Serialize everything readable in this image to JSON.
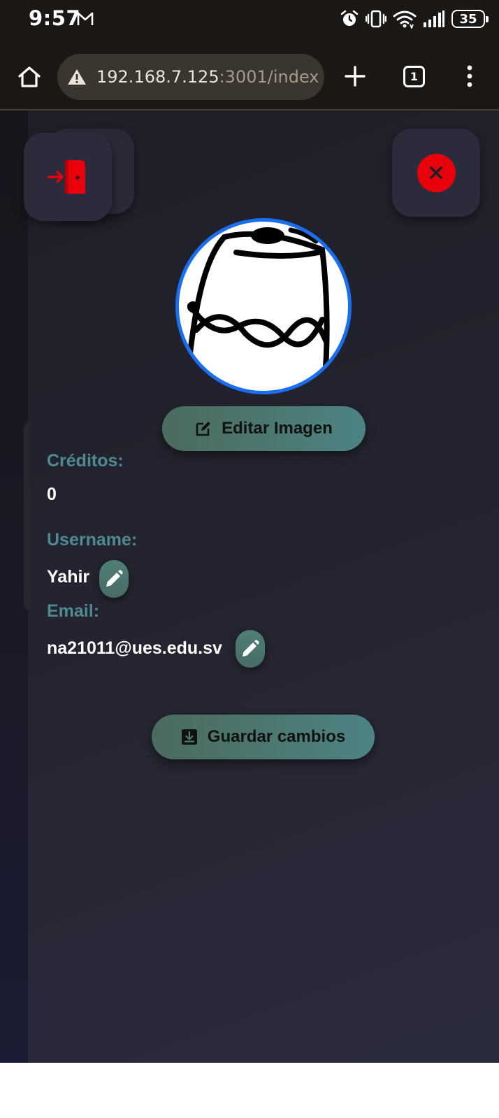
{
  "status_bar": {
    "time": "9:57",
    "battery_level": "35",
    "icons": [
      "gmail-icon",
      "alarm-icon",
      "vibrate-icon",
      "wifi-icon",
      "signal-icon",
      "battery-icon"
    ]
  },
  "browser": {
    "url_host": "192.168.7.125",
    "url_path": ":3001/index",
    "tab_count": "1",
    "icons": [
      "home-icon",
      "not-secure-warning-icon",
      "new-tab-plus-icon",
      "tab-switcher-icon",
      "overflow-menu-icon"
    ]
  },
  "profile": {
    "edit_image_label": "Editar Imagen",
    "credits_label": "Créditos:",
    "credits_value": "0",
    "username_label": "Username:",
    "username_value": "Yahir",
    "email_label": "Email:",
    "email_value": "na21011@ues.edu.sv",
    "save_label": "Guardar cambios"
  },
  "colors": {
    "accent_label": "#4f8a91",
    "button_gradient_start": "#4b6b5d",
    "button_gradient_end": "#4d8384",
    "logout_red": "#e8000b",
    "avatar_border": "#1a6ef0",
    "page_background": "#252532"
  }
}
